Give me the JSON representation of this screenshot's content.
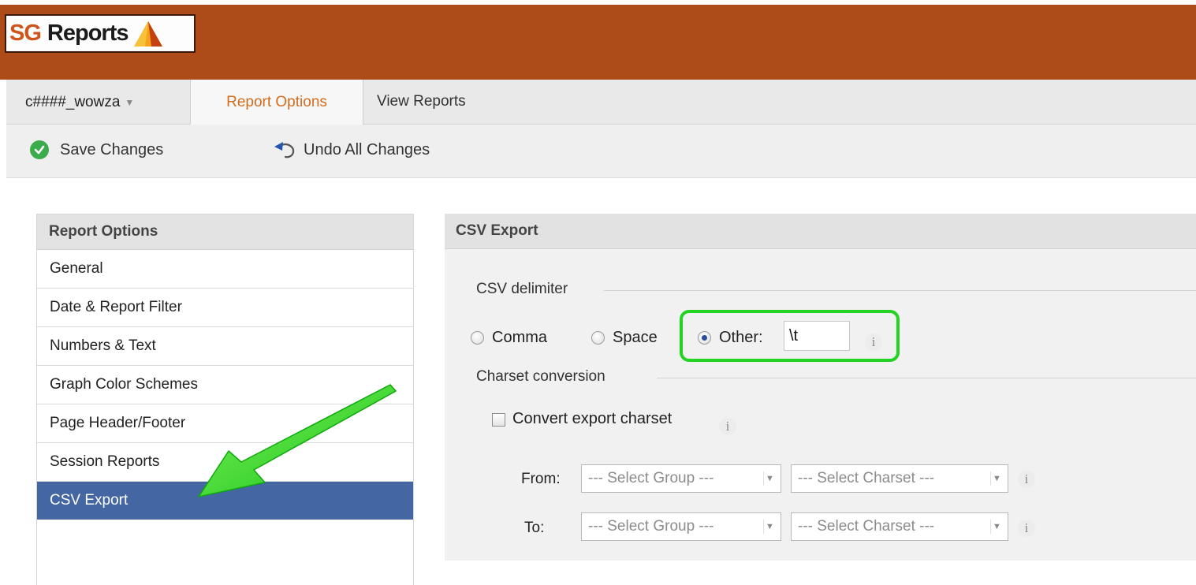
{
  "app": {
    "logo_sg": "SG",
    "logo_reports": "Reports",
    "brand_color": "#ad4b19"
  },
  "tabs": {
    "user_label": "c####_wowza",
    "report_options": "Report Options",
    "view_reports": "View Reports"
  },
  "toolbar": {
    "save_label": "Save Changes",
    "undo_label": "Undo All Changes"
  },
  "menu": {
    "header": "Report Options",
    "items": [
      {
        "label": "General"
      },
      {
        "label": "Date & Report Filter"
      },
      {
        "label": "Numbers & Text"
      },
      {
        "label": "Graph Color Schemes"
      },
      {
        "label": "Page Header/Footer"
      },
      {
        "label": "Session Reports"
      },
      {
        "label": "CSV Export",
        "active": true
      }
    ],
    "active_color": "#4467a3"
  },
  "panel": {
    "header": "CSV Export",
    "delimiter": {
      "legend": "CSV delimiter",
      "options": [
        "Comma",
        "Space",
        "Other:"
      ],
      "selected": "Other:",
      "other_value": "\\t"
    },
    "charset": {
      "legend": "Charset conversion",
      "convert_label": "Convert export charset",
      "convert_checked": false,
      "from_label": "From:",
      "to_label": "To:",
      "group_placeholder": "--- Select Group ---",
      "charset_placeholder": "--- Select Charset ---"
    },
    "info_glyph": "i",
    "highlight_color": "#22d322"
  }
}
